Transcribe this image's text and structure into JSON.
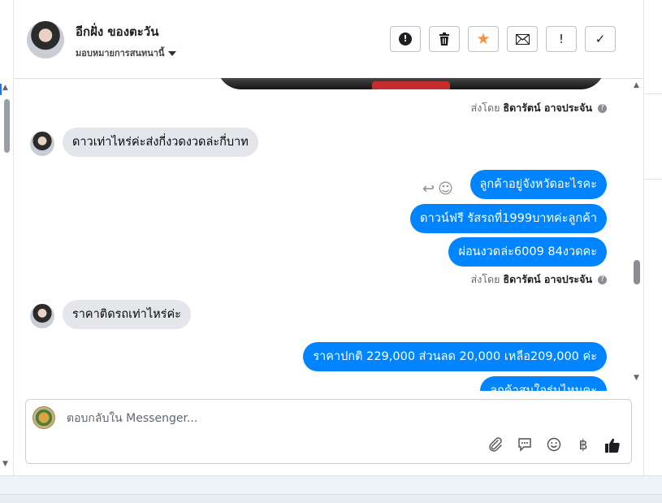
{
  "header": {
    "contact_name": "อีกฝั่ง ของตะวัน",
    "assign_label": "มอบหมายการสนทนานี้",
    "buttons": [
      {
        "name": "report-button",
        "glyph": "!"
      },
      {
        "name": "delete-button",
        "glyph": "🗑"
      },
      {
        "name": "star-button",
        "glyph": "★"
      },
      {
        "name": "mark-unread-button",
        "glyph": "✉"
      },
      {
        "name": "important-button",
        "glyph": "!"
      },
      {
        "name": "done-button",
        "glyph": "✓"
      }
    ]
  },
  "thread": {
    "sent_by_prefix": "ส่งโดย",
    "sent_by_name": "ธิดารัตน์ อาจประจัน",
    "messages_in": [
      "ดาวเท่าไหร่ค่ะส่งกี่งวดงวดล่ะกี่บาท",
      "ราคาติดรถเท่าไหร่ค่ะ"
    ],
    "messages_out": [
      "ลูกค้าอยู่จังหวัดอะไรคะ",
      "ดาวน์ฟรี รัสรถที่1999บาทค่ะลูกค้า",
      "ผ่อนงวดล่ะ6009 84งวดคะ",
      "ราคาปกติ 229,000 ส่วนลด 20,000 เหลือ209,000 ค่ะ",
      "ลูกค้าสนใจรุ่นไหนคะ"
    ]
  },
  "composer": {
    "placeholder": "ตอบกลับใน Messenger..."
  },
  "icons": {
    "attach": "attachment-icon",
    "saved_reply": "saved-reply-icon",
    "emoji": "emoji-icon",
    "payment": "baht-icon",
    "like": "thumbs-up-icon"
  },
  "colors": {
    "outgoing_bubble": "#0084ff",
    "incoming_bubble": "#e4e6eb",
    "star": "#f7923a"
  }
}
